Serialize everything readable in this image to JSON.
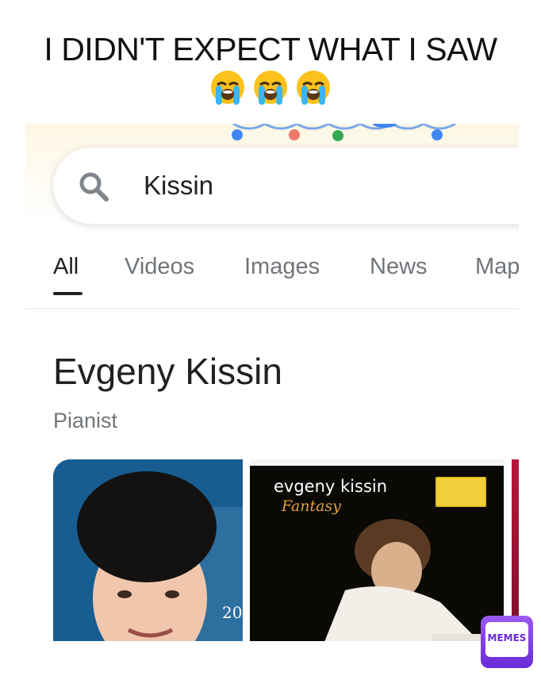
{
  "meme": {
    "caption": "I DIDN'T EXPECT WHAT I SAW",
    "emoji_icons": [
      "loudly-crying-face-icon",
      "loudly-crying-face-icon",
      "loudly-crying-face-icon"
    ],
    "watermark_icon": "memes-logo-icon",
    "watermark_text": "MEMES"
  },
  "search": {
    "query": "Kissin",
    "icon": "search-icon"
  },
  "tabs": [
    {
      "label": "All",
      "active": true
    },
    {
      "label": "Videos",
      "active": false
    },
    {
      "label": "Images",
      "active": false
    },
    {
      "label": "News",
      "active": false
    },
    {
      "label": "Map",
      "active": false
    }
  ],
  "knowledge_panel": {
    "title": "Evgeny Kissin",
    "subtitle": "Pianist",
    "images": [
      {
        "name": "portrait-photo"
      },
      {
        "name": "album-cover",
        "line1": "evgeny kissin",
        "line2": "Fantasy"
      },
      {
        "name": "third-image"
      }
    ]
  },
  "colors": {
    "accent_text": "#202124",
    "muted_text": "#70757a",
    "banner_bg": "#fdf7e4",
    "watermark": "#7b3ee6"
  }
}
